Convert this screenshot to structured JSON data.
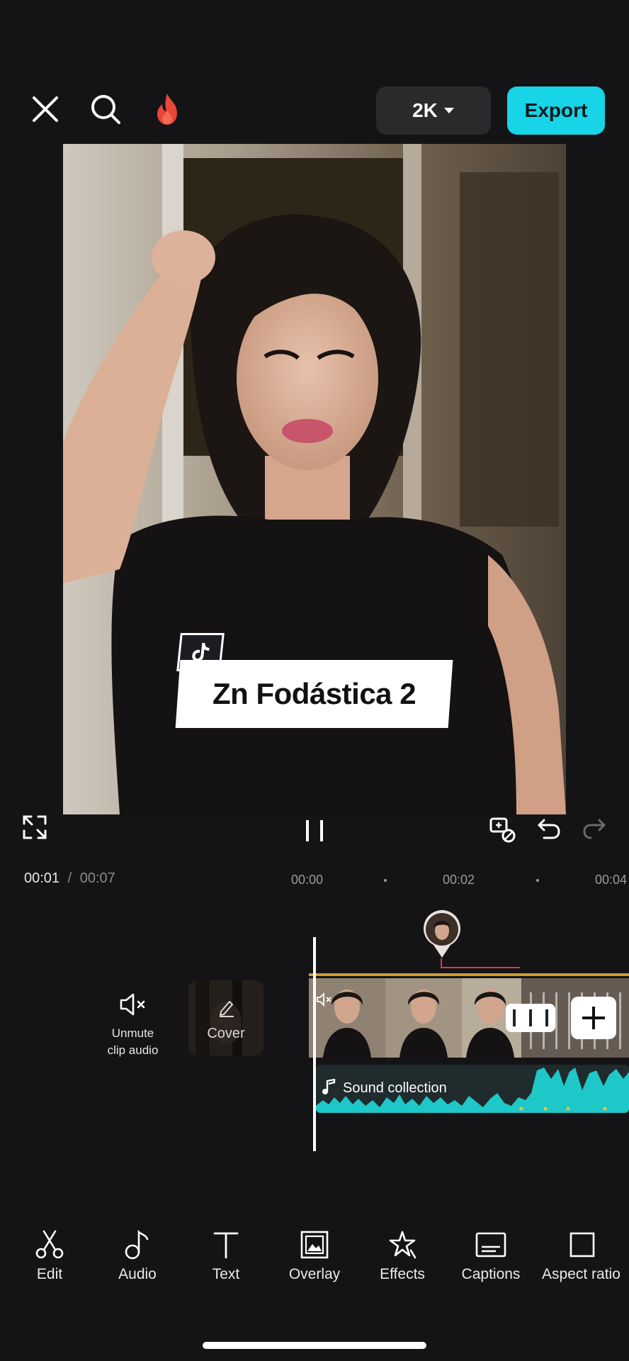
{
  "topbar": {
    "resolution_label": "2K",
    "export_label": "Export"
  },
  "preview": {
    "caption_text": "Zn Fodástica 2"
  },
  "timeline": {
    "current_time": "00:01",
    "separator": "/",
    "total_time": "00:07",
    "ruler_labels": [
      "00:00",
      "00:02",
      "00:04"
    ],
    "unmute_label_line1": "Unmute",
    "unmute_label_line2": "clip audio",
    "cover_label": "Cover",
    "audio_track_label": "Sound collection"
  },
  "toolbar": {
    "items": [
      {
        "label": "Edit",
        "icon": "scissors-icon"
      },
      {
        "label": "Audio",
        "icon": "music-note-icon"
      },
      {
        "label": "Text",
        "icon": "text-icon"
      },
      {
        "label": "Overlay",
        "icon": "overlay-icon"
      },
      {
        "label": "Effects",
        "icon": "effects-star-icon"
      },
      {
        "label": "Captions",
        "icon": "captions-icon"
      },
      {
        "label": "Aspect ratio",
        "icon": "aspect-ratio-icon"
      }
    ]
  },
  "colors": {
    "accent": "#17d4e6",
    "background": "#141416",
    "audio_wave": "#1ec8c8",
    "clip_border": "#d29a2e",
    "flame": "#e8473a"
  }
}
